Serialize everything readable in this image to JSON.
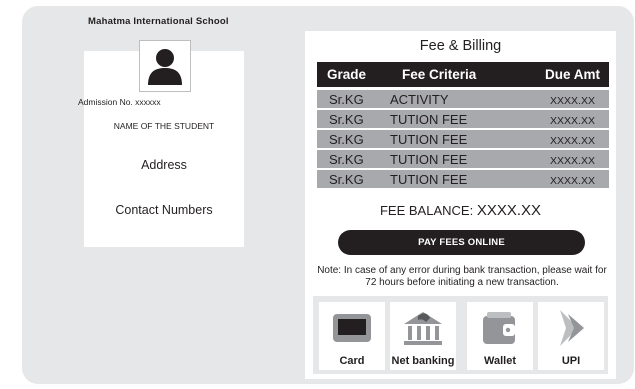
{
  "school": {
    "name": "Mahatma International School"
  },
  "student": {
    "admission": "Admission No. xxxxxx",
    "name": "NAME OF THE STUDENT",
    "address": "Address",
    "contact": "Contact Numbers",
    "avatar_icon": "user-icon"
  },
  "fee": {
    "title": "Fee & Billing",
    "columns": [
      "Grade",
      "Fee Criteria",
      "Due Amt"
    ],
    "rows": [
      {
        "grade": "Sr.KG",
        "criteria": "ACTIVITY",
        "amount": "XXXX.XX"
      },
      {
        "grade": "Sr.KG",
        "criteria": "TUTION FEE",
        "amount": "XXXX.XX"
      },
      {
        "grade": "Sr.KG",
        "criteria": "TUTION FEE",
        "amount": "XXXX.XX"
      },
      {
        "grade": "Sr.KG",
        "criteria": "TUTION FEE",
        "amount": "XXXX.XX"
      },
      {
        "grade": "Sr.KG",
        "criteria": "TUTION FEE",
        "amount": "XXXX.XX"
      }
    ],
    "balance_label": "FEE BALANCE:",
    "balance_value": "XXXX.XX",
    "pay_button": "PAY FEES ONLINE",
    "note": "Note: In case of any error during bank transaction, please wait for 72 hours before initiating a new transaction."
  },
  "payment_methods": [
    {
      "label": "Card",
      "icon": "card-icon"
    },
    {
      "label": "Net banking",
      "icon": "bank-icon"
    },
    {
      "label": "Wallet",
      "icon": "wallet-icon"
    },
    {
      "label": "UPI",
      "icon": "upi-icon"
    }
  ],
  "colors": {
    "panel": "#e6e7e8",
    "dark": "#231f20",
    "row": "#a7a9ac"
  }
}
